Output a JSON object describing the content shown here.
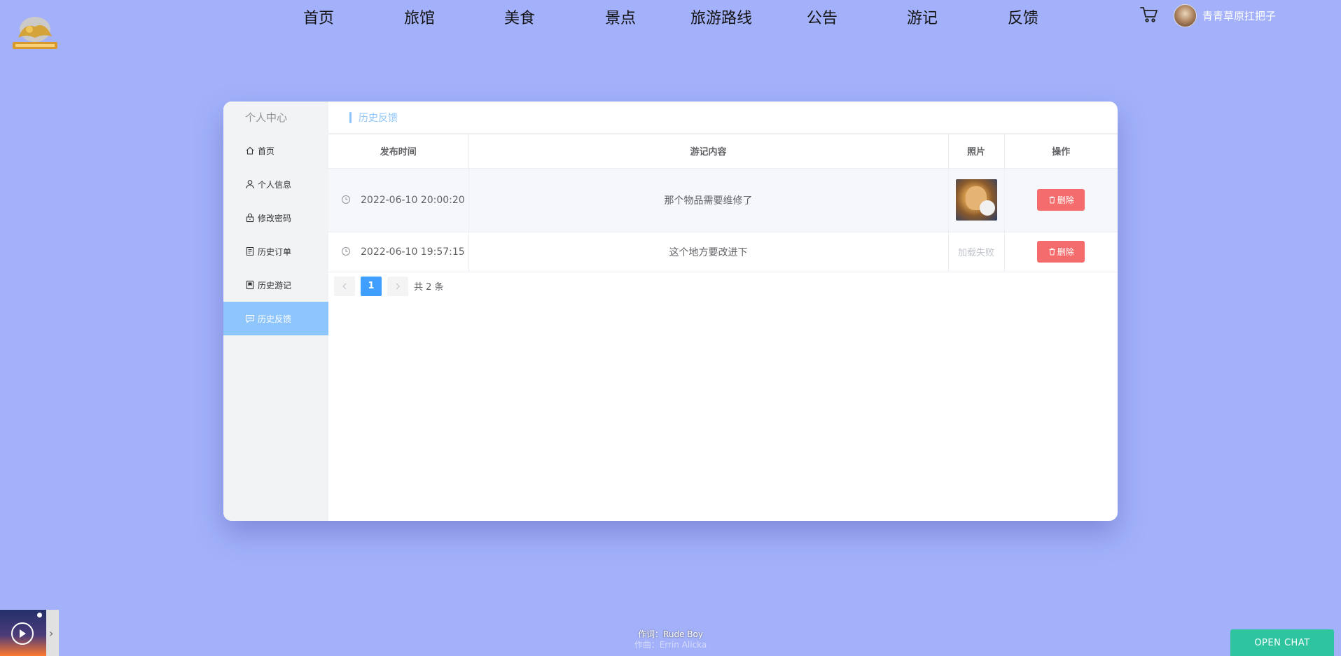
{
  "nav": {
    "items": [
      "首页",
      "旅馆",
      "美食",
      "景点",
      "旅游路线",
      "公告",
      "游记",
      "反馈"
    ],
    "username": "青青草原扛把子"
  },
  "sidebar": {
    "title": "个人中心",
    "items": [
      {
        "label": "首页",
        "icon": "home-icon"
      },
      {
        "label": "个人信息",
        "icon": "user-icon"
      },
      {
        "label": "修改密码",
        "icon": "lock-icon"
      },
      {
        "label": "历史订单",
        "icon": "order-icon"
      },
      {
        "label": "历史游记",
        "icon": "notebook-icon"
      },
      {
        "label": "历史反馈",
        "icon": "chat-icon"
      }
    ],
    "active_index": 5
  },
  "breadcrumb": "历史反馈",
  "table": {
    "headers": [
      "发布时间",
      "游记内容",
      "照片",
      "操作"
    ],
    "rows": [
      {
        "time": "2022-06-10 20:00:20",
        "content": "那个物品需要维修了",
        "photo": "image",
        "action": "删除"
      },
      {
        "time": "2022-06-10 19:57:15",
        "content": "这个地方要改进下",
        "photo_text": "加载失败",
        "action": "删除"
      }
    ]
  },
  "pagination": {
    "current": "1",
    "total": "共 2 条"
  },
  "player": {
    "line1": "作词：Rude Boy",
    "line2": "作曲：Errin Alicka"
  },
  "chat": {
    "label": "OPEN CHAT"
  },
  "colors": {
    "background": "#a3b1fa",
    "accent": "#8ec5fc",
    "danger": "#f56c6c",
    "primary": "#409eff",
    "chat": "#2ec4a0"
  }
}
